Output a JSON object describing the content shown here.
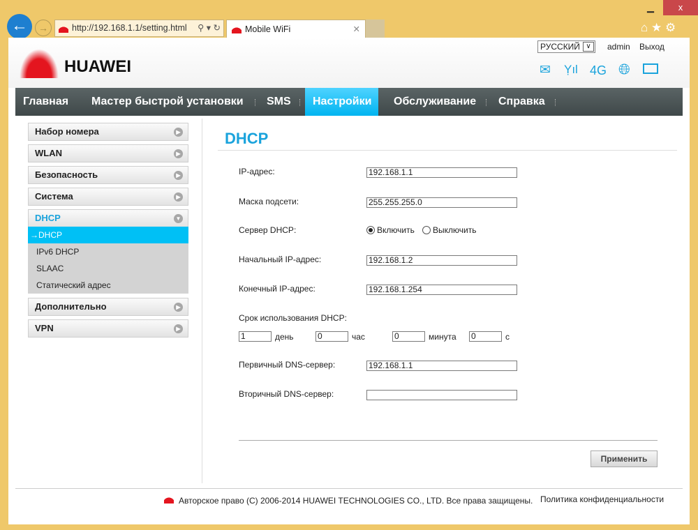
{
  "browser": {
    "url": "http://192.168.1.1/setting.html",
    "tab_title": "Mobile WiFi",
    "minimize": "▁",
    "maximize": "☐",
    "close": "x"
  },
  "header": {
    "brand": "HUAWEI",
    "language": "РУССКИЙ",
    "user": "admin",
    "logout": "Выход",
    "network": "4G"
  },
  "nav": [
    "Главная",
    "Мастер быстрой установки",
    "SMS",
    "Настройки",
    "Обслуживание",
    "Справка"
  ],
  "sidebar": {
    "items": [
      "Набор номера",
      "WLAN",
      "Безопасность",
      "Система",
      "DHCP",
      "Дополнительно",
      "VPN"
    ],
    "subitems": [
      "→DHCP",
      "IPv6 DHCP",
      "SLAAC",
      "Статический адрес"
    ]
  },
  "main": {
    "title": "DHCP",
    "ip_label": "IP-адрес:",
    "ip": "192.168.1.1",
    "mask_label": "Маска подсети:",
    "mask": "255.255.255.0",
    "server_label": "Сервер DHCP:",
    "enable": "Включить",
    "disable": "Выключить",
    "start_label": "Начальный IP-адрес:",
    "start": "192.168.1.2",
    "end_label": "Конечный IP-адрес:",
    "end": "192.168.1.254",
    "lease_label": "Срок использования DHCP:",
    "lease": [
      {
        "value": "1",
        "unit": "день"
      },
      {
        "value": "0",
        "unit": "час"
      },
      {
        "value": "0",
        "unit": "минута"
      },
      {
        "value": "0",
        "unit": "с"
      }
    ],
    "dns1_label": "Первичный DNS-сервер:",
    "dns1": "192.168.1.1",
    "dns2_label": "Вторичный DNS-сервер:",
    "dns2": "",
    "apply": "Применить"
  },
  "footer": {
    "copyright": "Авторское право (C) 2006-2014 HUAWEI TECHNOLOGIES CO., LTD. Все права защищены.",
    "privacy": "Политика конфиденциальности"
  },
  "colors": {
    "accent": "#00b4f0",
    "frame": "#efc86a",
    "brand_red": "#e4151f"
  }
}
